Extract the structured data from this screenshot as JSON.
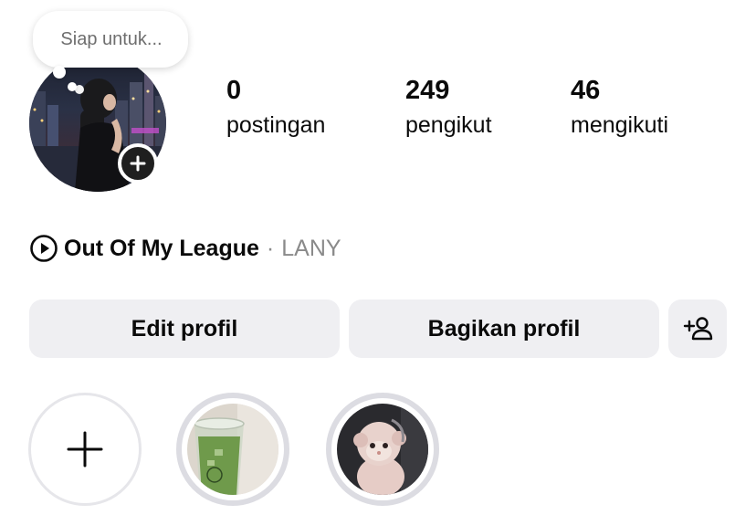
{
  "note": {
    "text": "Siap untuk..."
  },
  "stats": [
    {
      "value": "0",
      "label": "postingan"
    },
    {
      "value": "249",
      "label": "pengikut"
    },
    {
      "value": "46",
      "label": "mengikuti"
    }
  ],
  "music": {
    "title": "Out Of My League",
    "separator": "·",
    "artist": "LANY"
  },
  "buttons": {
    "edit": "Edit profil",
    "share": "Bagikan profil"
  },
  "icons": {
    "avatar_add": "plus-icon",
    "music": "play-circle-icon",
    "add_person": "add-person-icon",
    "new_highlight": "plus-icon"
  },
  "colors": {
    "button_bg": "#efeff2",
    "secondary_text": "#8a8a8a",
    "badge_bg": "#1f1f1f"
  },
  "highlights": [
    {
      "type": "new"
    },
    {
      "type": "image",
      "subject": "matcha-drink"
    },
    {
      "type": "image",
      "subject": "plush-toy"
    }
  ]
}
